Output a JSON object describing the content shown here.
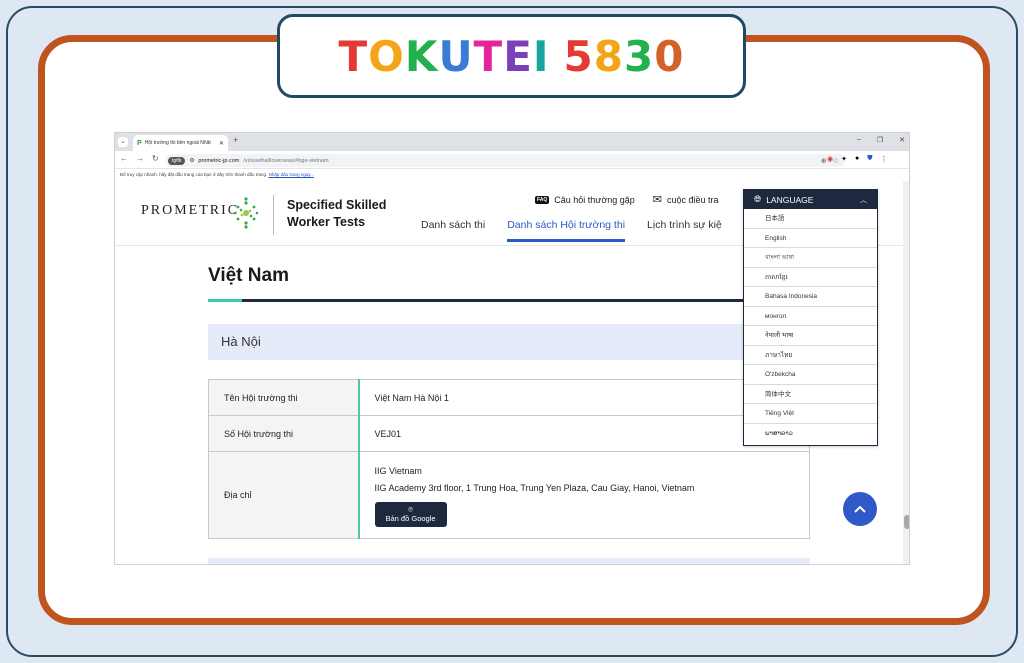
{
  "banner": {
    "letters": [
      {
        "ch": "T",
        "color": "#e53935"
      },
      {
        "ch": "O",
        "color": "#f4a417"
      },
      {
        "ch": "K",
        "color": "#22b14c"
      },
      {
        "ch": "U",
        "color": "#3a7bd5"
      },
      {
        "ch": "T",
        "color": "#e5239b"
      },
      {
        "ch": "E",
        "color": "#7b3fb8"
      },
      {
        "ch": "I",
        "color": "#1aa3a3"
      },
      {
        "ch": " ",
        "color": "#000000"
      },
      {
        "ch": "5",
        "color": "#e53935"
      },
      {
        "ch": "8",
        "color": "#f4a417"
      },
      {
        "ch": "3",
        "color": "#22b14c"
      },
      {
        "ch": "0",
        "color": "#d4612a"
      }
    ]
  },
  "browser": {
    "tab_title": "Hội trường thi bên ngoài Nhật",
    "tab_favicon": "P",
    "new_tab": "+",
    "window_controls": [
      "–",
      "❐",
      "✕"
    ],
    "nav": {
      "back": "←",
      "forward": "→",
      "reload": "↻"
    },
    "chip": "tgtfk",
    "url_host": "prometric-jp.com",
    "url_path": "/vi/ssw/hall/overseas/#bge-vietnam",
    "infobar_text": "Để truy cập nhanh, hãy đặt dấu trang của bạn ở đây trên thanh dấu trang.",
    "infobar_link": "Nhập dấu trang ngay..."
  },
  "header": {
    "logo_text": "PROMETRIC",
    "site_title_line1": "Specified Skilled",
    "site_title_line2": "Worker Tests",
    "util_faq_badge": "FAQ",
    "util_faq": "Câu hỏi thường gặp",
    "util_survey": "cuộc điều tra",
    "nav": [
      "Danh sách thi",
      "Danh sách Hội trường thi",
      "Lịch trình sự kiệ"
    ],
    "nav_active_index": 1
  },
  "main": {
    "country": "Việt Nam",
    "city": "Hà Nội",
    "rows": {
      "hall_name_label": "Tên Hội trường thi",
      "hall_name_value": "Việt Nam Hà Nội 1",
      "hall_no_label": "Số Hội trường thi",
      "hall_no_value": "VEJ01",
      "address_label": "Địa chỉ",
      "address_line1": "IIG Vietnam",
      "address_line2": "IIG Academy 3rd floor, 1 Trung Hoa, Trung Yen Plaza, Cau Giay, Hanoi, Vietnam",
      "map_button": "Bản đồ Google"
    }
  },
  "language": {
    "header": "LANGUAGE",
    "items": [
      "日本語",
      "English",
      "বাংলা ভাষা",
      "ភាសាខ្មែរ",
      "Bahasa Indonesia",
      "монгол",
      "नेपाली भाषा",
      "ภาษาไทย",
      "O'zbekcha",
      "简体中文",
      "Tiếng Việt",
      "ພາສາລາວ"
    ]
  },
  "colors": {
    "accent": "#2f58c8",
    "navy": "#1e2940",
    "teal": "#3cc8b8",
    "frame_orange": "#c0541f"
  }
}
